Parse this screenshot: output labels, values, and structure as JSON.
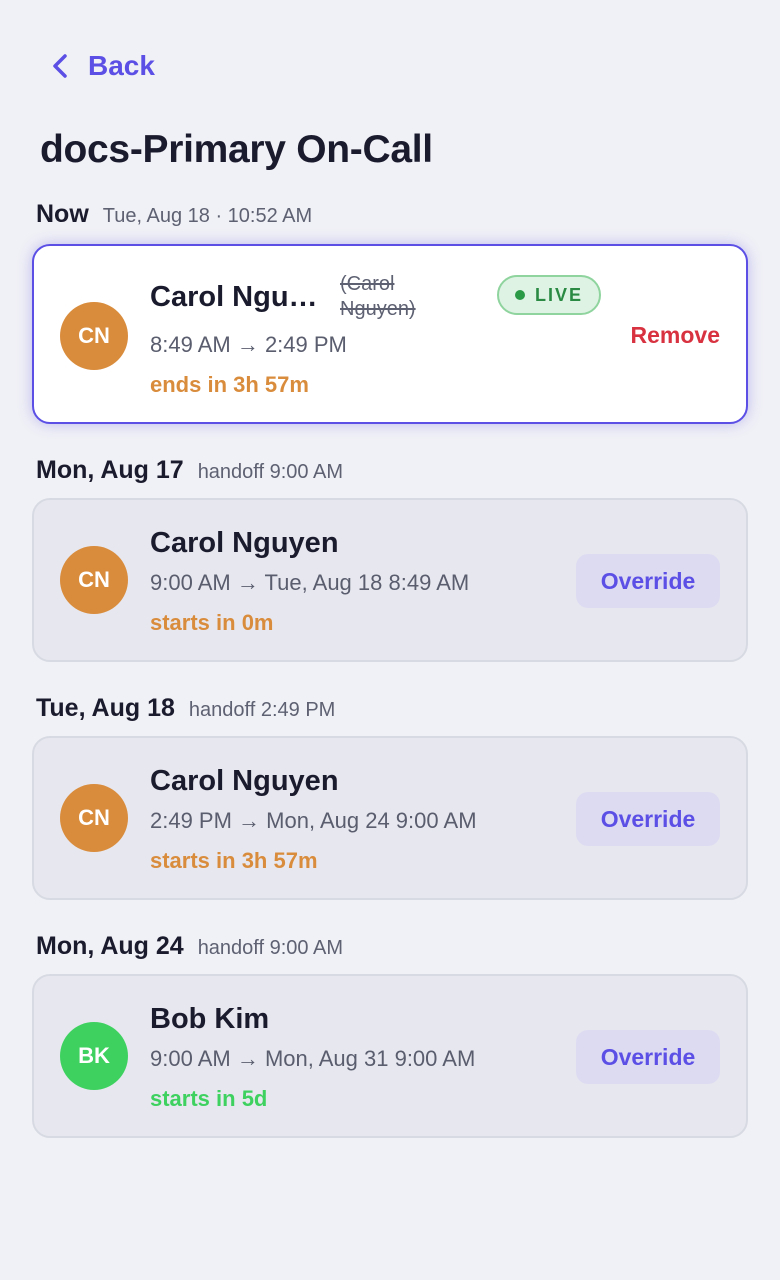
{
  "nav": {
    "back_label": "Back"
  },
  "page": {
    "title": "docs-Primary On-Call"
  },
  "sections": [
    {
      "day": "Now",
      "sub": "Tue, Aug 18 · 10:52 AM",
      "shift": {
        "initials": "CN",
        "avatar_color": "#d98c3c",
        "name": "Carol Ngu…",
        "replaced_name": "(Carol Nguyen)",
        "time": "8:49 AM → 2:49 PM",
        "status": "ends in 3h 57m",
        "status_color": "#d98c3c",
        "badge": "LIVE",
        "action": "Remove"
      }
    },
    {
      "day": "Mon, Aug 17",
      "sub": "handoff 9:00 AM",
      "shift": {
        "initials": "CN",
        "avatar_color": "#d98c3c",
        "name": "Carol Nguyen",
        "time": "9:00 AM → Tue, Aug 18 8:49 AM",
        "status": "starts in 0m",
        "status_color": "#d98c3c",
        "action": "Override"
      }
    },
    {
      "day": "Tue, Aug 18",
      "sub": "handoff 2:49 PM",
      "shift": {
        "initials": "CN",
        "avatar_color": "#d98c3c",
        "name": "Carol Nguyen",
        "time": "2:49 PM → Mon, Aug 24 9:00 AM",
        "status": "starts in 3h 57m",
        "status_color": "#d98c3c",
        "action": "Override"
      }
    },
    {
      "day": "Mon, Aug 24",
      "sub": "handoff 9:00 AM",
      "shift": {
        "initials": "BK",
        "avatar_color": "#3ed160",
        "name": "Bob Kim",
        "time": "9:00 AM → Mon, Aug 31 9:00 AM",
        "status": "starts in 5d",
        "status_color": "#3ed160",
        "action": "Override"
      }
    }
  ],
  "colors": {
    "accent": "#5b4fe6",
    "remove": "#d8313f",
    "live_green": "#2a8a43",
    "background": "#f0f1f6"
  }
}
